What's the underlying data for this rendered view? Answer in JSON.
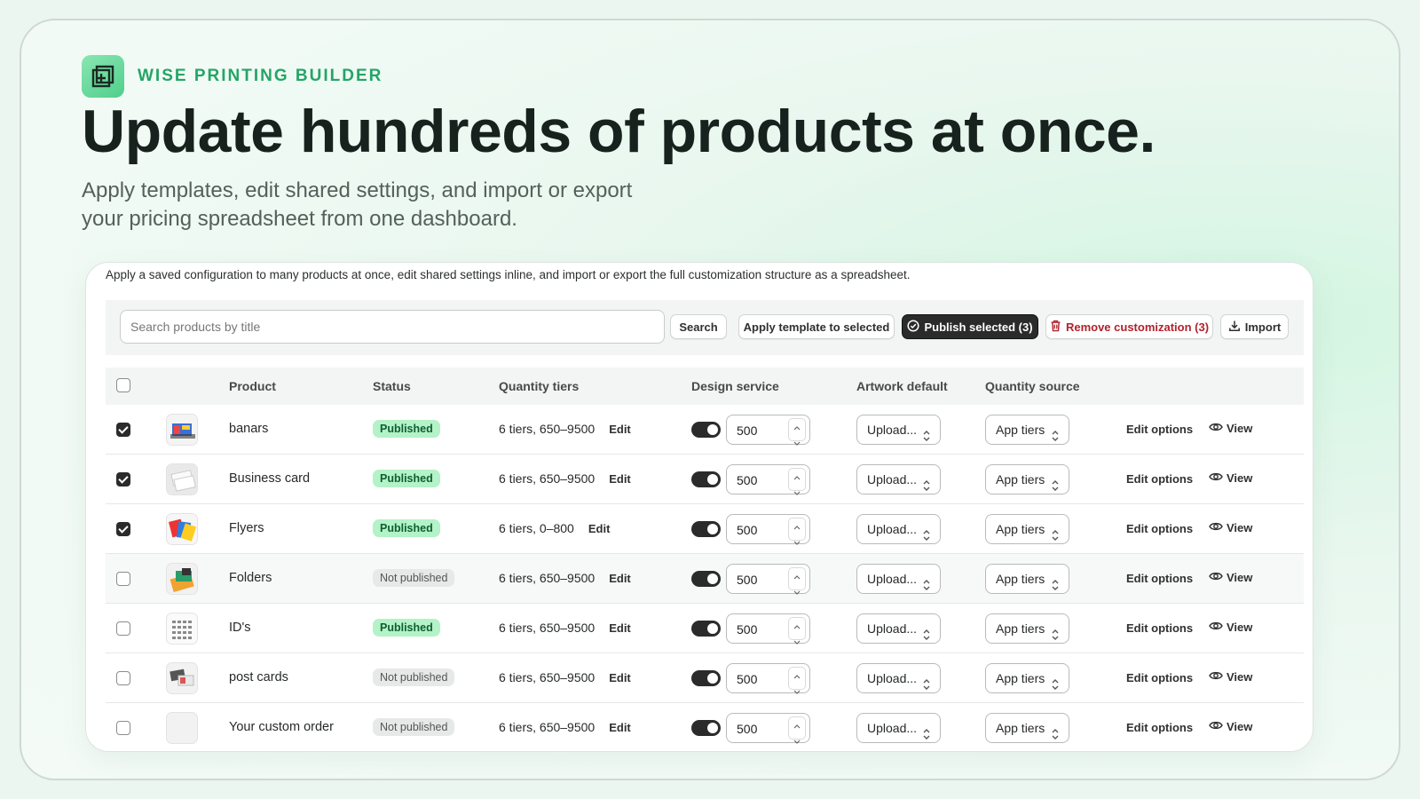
{
  "brand": {
    "name": "WISE PRINTING BUILDER",
    "icon": "add-window-icon",
    "accent": "#24a566"
  },
  "hero": {
    "headline": "Update hundreds of products at once.",
    "subtitle": "Apply templates, edit shared settings, and import or export your pricing spreadsheet from one dashboard."
  },
  "card": {
    "description": "Apply a saved configuration to many products at once, edit shared settings inline, and import or export the full customization structure as a spreadsheet.",
    "search": {
      "placeholder": "Search products by title",
      "value": ""
    },
    "toolbar": {
      "search_label": "Search",
      "apply_template_label": "Apply template to selected",
      "publish_label": "Publish selected (3)",
      "remove_label": "Remove customization (3)",
      "import_label": "Import"
    },
    "columns": {
      "product": "Product",
      "status": "Status",
      "tiers": "Quantity tiers",
      "design": "Design service",
      "artwork": "Artwork default",
      "source": "Quantity source"
    },
    "rows": [
      {
        "name": "banars",
        "status": "Published",
        "published": true,
        "checked": true,
        "tiers": "6 tiers, 650–9500",
        "edit": "Edit",
        "design_on": true,
        "design_price": "500",
        "artwork": "Upload...",
        "source": "App tiers",
        "edit_options": "Edit options",
        "view": "View",
        "thumb": "banner"
      },
      {
        "name": "Business card",
        "status": "Published",
        "published": true,
        "checked": true,
        "tiers": "6 tiers, 650–9500",
        "edit": "Edit",
        "design_on": true,
        "design_price": "500",
        "artwork": "Upload...",
        "source": "App tiers",
        "edit_options": "Edit options",
        "view": "View",
        "thumb": "cards"
      },
      {
        "name": "Flyers",
        "status": "Published",
        "published": true,
        "checked": true,
        "tiers": "6 tiers, 0–800",
        "edit": "Edit",
        "design_on": true,
        "design_price": "500",
        "artwork": "Upload...",
        "source": "App tiers",
        "edit_options": "Edit options",
        "view": "View",
        "thumb": "flyers"
      },
      {
        "name": "Folders",
        "status": "Not published",
        "published": false,
        "checked": false,
        "tiers": "6 tiers, 650–9500",
        "edit": "Edit",
        "design_on": true,
        "design_price": "500",
        "artwork": "Upload...",
        "source": "App tiers",
        "edit_options": "Edit options",
        "view": "View",
        "thumb": "folders"
      },
      {
        "name": "ID's",
        "status": "Published",
        "published": true,
        "checked": false,
        "tiers": "6 tiers, 650–9500",
        "edit": "Edit",
        "design_on": true,
        "design_price": "500",
        "artwork": "Upload...",
        "source": "App tiers",
        "edit_options": "Edit options",
        "view": "View",
        "thumb": "ids"
      },
      {
        "name": "post cards",
        "status": "Not published",
        "published": false,
        "checked": false,
        "tiers": "6 tiers, 650–9500",
        "edit": "Edit",
        "design_on": true,
        "design_price": "500",
        "artwork": "Upload...",
        "source": "App tiers",
        "edit_options": "Edit options",
        "view": "View",
        "thumb": "postcards"
      },
      {
        "name": "Your custom order",
        "status": "Not published",
        "published": false,
        "checked": false,
        "tiers": "6 tiers, 650–9500",
        "edit": "Edit",
        "design_on": true,
        "design_price": "500",
        "artwork": "Upload...",
        "source": "App tiers",
        "edit_options": "Edit options",
        "view": "View",
        "thumb": "blank"
      }
    ]
  },
  "colors": {
    "published_bg": "#b4f2c8",
    "published_text": "#0d5f2f",
    "danger": "#b1222c",
    "primary_dark": "#2b2b2b"
  }
}
